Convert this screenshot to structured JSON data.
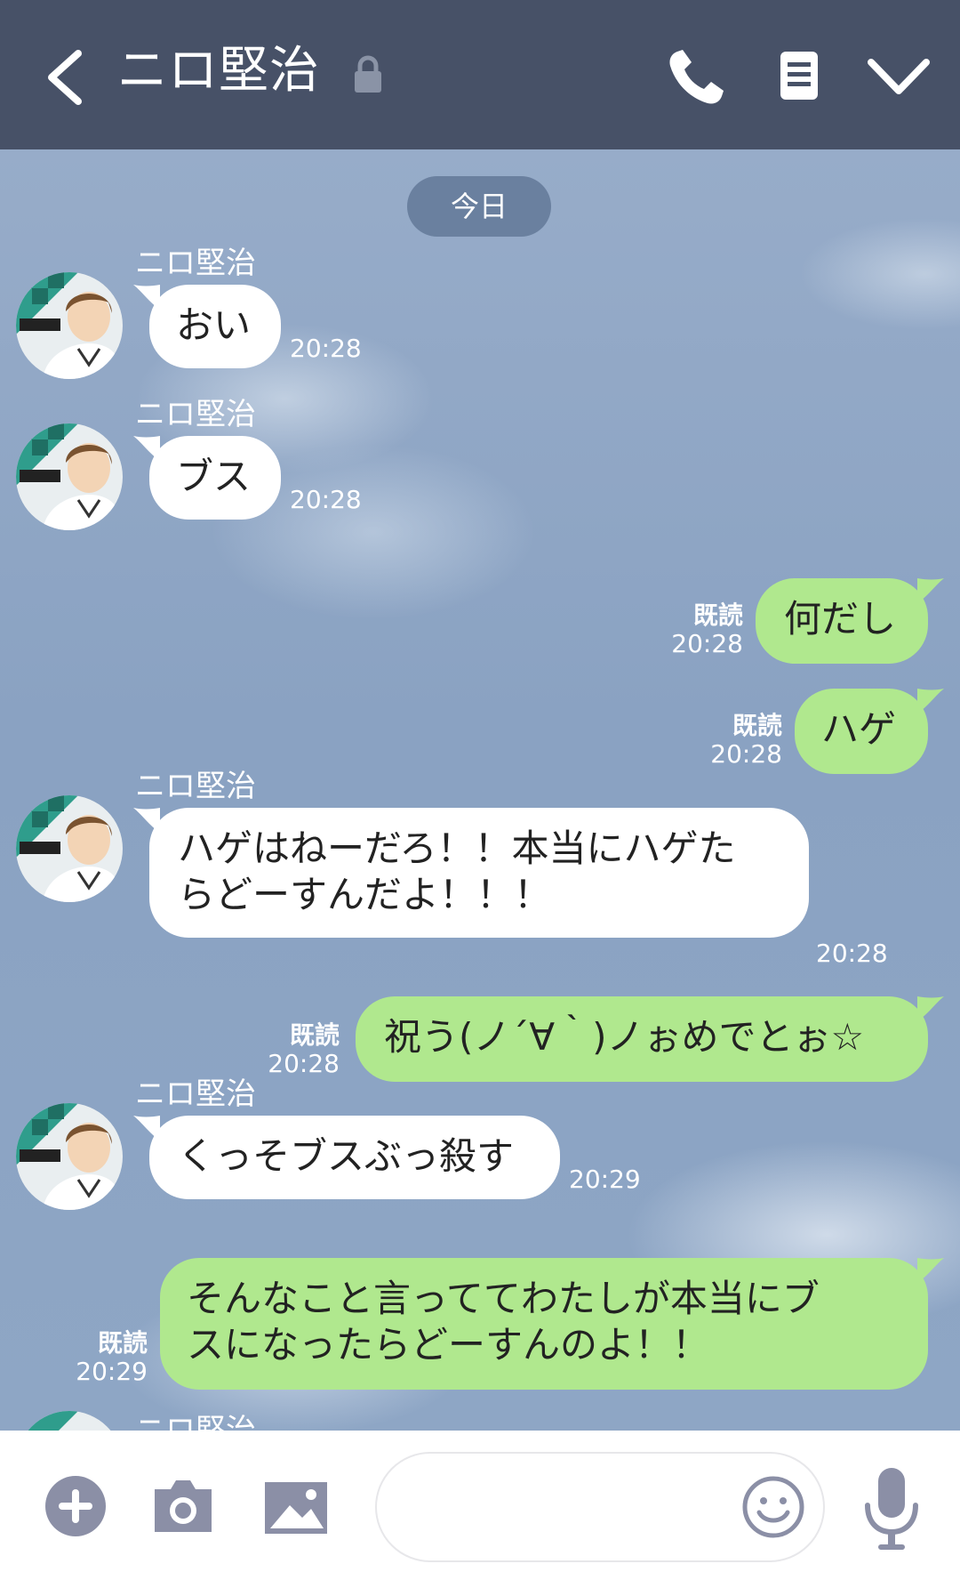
{
  "header": {
    "title": "ニロ堅治"
  },
  "date_label": "今日",
  "messages": [
    {
      "sender": "ニロ堅治",
      "text": "おい",
      "time": "20:28"
    },
    {
      "sender": "ニロ堅治",
      "text": "ブス",
      "time": "20:28"
    },
    {
      "text": "何だし",
      "read": "既読",
      "time": "20:28"
    },
    {
      "text": "ハゲ",
      "read": "既読",
      "time": "20:28"
    },
    {
      "sender": "ニロ堅治",
      "line1": "ハゲはねーだろ！！本当にハゲた",
      "line2": "らどーすんだよ！！！",
      "time": "20:28"
    },
    {
      "text": "祝う(ノ´∀｀)ノぉめでとぉ☆",
      "read": "既読",
      "time": "20:28"
    },
    {
      "sender": "ニロ堅治",
      "text": "くっそブスぶっ殺す",
      "time": "20:29"
    },
    {
      "line1": "そんなこと言っててわたしが本当にブ",
      "line2": "スになったらどーすんのよ！！",
      "read": "既読",
      "time": "20:29"
    },
    {
      "sender": "ニロ堅治"
    }
  ],
  "icons": {
    "back": "chevron-left-icon",
    "lock": "lock-icon",
    "call": "phone-icon",
    "notes": "notes-icon",
    "menu": "chevron-down-icon",
    "plus": "plus-icon",
    "camera": "camera-icon",
    "image": "image-icon",
    "emoji": "emoji-icon",
    "mic": "microphone-icon"
  },
  "colors": {
    "header_bg": "#475167",
    "out_bubble": "#b0e88e",
    "in_bubble": "#ffffff",
    "date_pill": "#6a809f"
  }
}
